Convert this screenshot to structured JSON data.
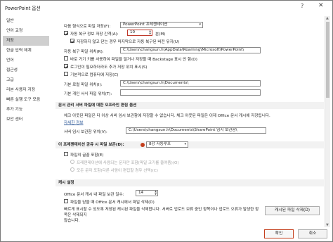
{
  "window": {
    "title": "PowerPoint 옵션",
    "help_glyph": "?",
    "close_glyph": "✕"
  },
  "sidebar": {
    "items": [
      {
        "label": "일반"
      },
      {
        "label": "언어 교정"
      },
      {
        "label": "저장",
        "selected": true
      },
      {
        "label": "한글 입력 체계"
      },
      {
        "label": "언어"
      },
      {
        "label": "접근성"
      },
      {
        "label": "고급"
      },
      {
        "label": "리본 사용자 지정"
      },
      {
        "label": "빠른 실행 도구 모음"
      },
      {
        "label": "추가 기능"
      },
      {
        "label": "보안 센터"
      }
    ]
  },
  "save": {
    "format_label": "다음 형식으로 파일 저장(F):",
    "format_value": "PowerPoint 프레젠테이션",
    "autorecover_label": "자동 복구 정보 저장 간격(A):",
    "autorecover_value": "10",
    "autorecover_unit": "분(M)",
    "keep_last_label": "저장하지 않고 닫는 경우 마지막으로 자동 복구된 버전 유지(U)",
    "autorecover_path_label": "자동 복구 파일 위치(R):",
    "autorecover_path_value": "C:\\Users\\changsun.h\\AppData\\Roaming\\Microsoft\\PowerPoint\\",
    "backstage_label": "바로 가기 키를 사용하여 파일을 열거나 저장할 때 Backstage 표시 안 함(O)",
    "more_locations_label": "로그인이 필요하더라도 추가 저장 위치 표시(S)",
    "default_computer_label": "기본적으로 컴퓨터에 저장(C)",
    "local_path_label": "기본 로컬 파일 위치(I):",
    "local_path_value": "C:\\Users\\changsun.h\\Documents\\",
    "template_path_label": "기본 개인 서식 파일 위치(T):",
    "template_path_value": ""
  },
  "offline": {
    "header": "문서 관리 서버 파일에 대한 오프라인 편집 옵션",
    "desc": "체크 아웃된 파일은 더 이상 서버 임시 보관함에 저장할 수 없습니다. 체크 아웃된 파일은 이제 Office 문서 캐시에 저장됩니다.",
    "more_link": "자세한 정보",
    "drafts_label": "서버 임시 보관함 위치(V):",
    "drafts_value": "C:\\Users\\changsun.h\\Documents\\SharePoint 임시 보관함\\"
  },
  "fidelity": {
    "header": "이 프레젠테이션 공유 시 파일 보존(D):",
    "presentation_value": "8강 자동루프",
    "embed_fonts_label": "파일의 글꼴 포함(E)",
    "embed_used_label": "프레젠테이션에 사용되는 문자만 포함(파일 크기를 줄여줌)(O)",
    "embed_all_label": "모든 문자 포함(다른 사람이 편집할 경우 선택)(C)"
  },
  "cache": {
    "header": "캐시 설정",
    "days_label": "Office 문서 캐시 내 파일 보관 일수:",
    "days_value": "14",
    "delete_on_close_label": "파일을 닫을 때 Office 문서 캐시에서 파일 삭제(D)",
    "desc_line1": "빠르게 표시할 수 있도록 저장된 캐시된 파일을 삭제합니다. 서버로 업로드 보류 중인 항목이나 업로드 오류가 발생한 항목은 삭제되지",
    "desc_line2": "않습니다.",
    "delete_button": "캐시된 파일 삭제(D)"
  },
  "footer": {
    "ok": "확인",
    "cancel": "취소"
  }
}
